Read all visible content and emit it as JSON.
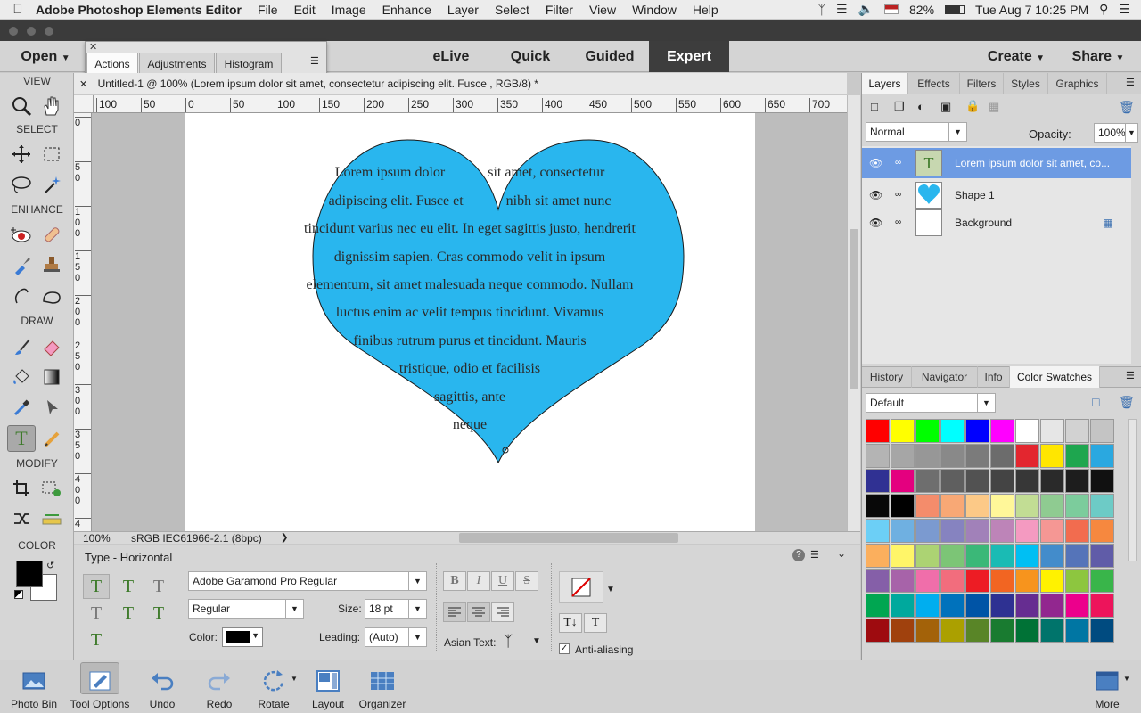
{
  "menubar": {
    "app": "Adobe Photoshop Elements Editor",
    "items": [
      "File",
      "Edit",
      "Image",
      "Enhance",
      "Layer",
      "Select",
      "Filter",
      "View",
      "Window",
      "Help"
    ],
    "battery": "82%",
    "datetime": "Tue Aug 7  10:25 PM"
  },
  "modebar": {
    "open": "Open",
    "modes": [
      "eLive",
      "Quick",
      "Guided",
      "Expert"
    ],
    "active": "Expert",
    "create": "Create",
    "share": "Share"
  },
  "floatpanel": {
    "tabs": [
      "Actions",
      "Adjustments",
      "Histogram"
    ],
    "active": "Actions"
  },
  "tools": {
    "sections": [
      "VIEW",
      "SELECT",
      "ENHANCE",
      "DRAW",
      "MODIFY",
      "COLOR"
    ]
  },
  "document": {
    "tab_title": "Untitled-1 @ 100% (Lorem ipsum dolor sit amet, consectetur adipiscing elit. Fusce , RGB/8) *",
    "zoom": "100%",
    "profile": "sRGB IEC61966-2.1 (8bpc)"
  },
  "rulers": {
    "h": [
      "100",
      "50",
      "0",
      "50",
      "100",
      "150",
      "200",
      "250",
      "300",
      "350",
      "400",
      "450",
      "500",
      "550",
      "600",
      "650",
      "700"
    ],
    "v": [
      "0",
      "5\n0",
      "1\n0\n0",
      "1\n5\n0",
      "2\n0\n0",
      "2\n5\n0",
      "3\n0\n0",
      "3\n5\n0",
      "4\n0\n0",
      "4"
    ]
  },
  "heart": {
    "fill": "#29b6ee",
    "lines": [
      "Lorem ipsum dolor            sit amet, consectetur",
      "adipiscing elit. Fusce et            nibh sit amet nunc",
      "tincidunt varius nec eu elit. In eget sagittis justo, hendrerit",
      "dignissim sapien. Cras commodo velit in ipsum",
      "elementum, sit amet malesuada neque commodo. Nullam",
      "luctus enim ac velit tempus tincidunt. Vivamus",
      "finibus rutrum purus et tincidunt. Mauris",
      "tristique, odio et facilisis",
      "sagittis, ante",
      "neque"
    ]
  },
  "tooloptions": {
    "title": "Type - Horizontal",
    "font": "Adobe Garamond Pro Regular",
    "style": "Regular",
    "size_label": "Size:",
    "size": "18 pt",
    "color_label": "Color:",
    "leading_label": "Leading:",
    "leading": "(Auto)",
    "asian_label": "Asian Text:",
    "antialias": "Anti-aliasing"
  },
  "layers_panel": {
    "tabs": [
      "Layers",
      "Effects",
      "Filters",
      "Styles",
      "Graphics"
    ],
    "active": "Layers",
    "blend": "Normal",
    "opacity_label": "Opacity:",
    "opacity": "100%",
    "layers": [
      "Lorem ipsum dolor sit amet, co...",
      "Shape 1",
      "Background"
    ]
  },
  "swatch_panel": {
    "tabs": [
      "History",
      "Navigator",
      "Info",
      "Color Swatches"
    ],
    "active": "Color Swatches",
    "preset": "Default",
    "colors": [
      "#ff0000",
      "#ffff00",
      "#00ff00",
      "#00ffff",
      "#0000ff",
      "#ff00ff",
      "#ffffff",
      "#e6e6e6",
      "#d2d2d2",
      "#c4c4c4",
      "#b4b4b4",
      "#a6a6a6",
      "#979797",
      "#898989",
      "#7b7b7b",
      "#6c6c6c",
      "#e3262f",
      "#ffe600",
      "#1ea64f",
      "#2aa8e0",
      "#303193",
      "#e4007f",
      "#6e6e6e",
      "#5f5f5f",
      "#525252",
      "#444444",
      "#373737",
      "#2a2a2a",
      "#1d1d1d",
      "#111111",
      "#080808",
      "#000000",
      "#f48c6b",
      "#f8a875",
      "#fcc987",
      "#fff799",
      "#c2dd94",
      "#8fcb91",
      "#7ccc9c",
      "#6dcbc6",
      "#6ccff6",
      "#6fb0e1",
      "#7b9ad0",
      "#8683c0",
      "#a181b9",
      "#bd84b8",
      "#f49ac1",
      "#f59794",
      "#f26c4f",
      "#f6883f",
      "#fbaf5d",
      "#fff568",
      "#acd373",
      "#7cc576",
      "#3bb878",
      "#1abbb4",
      "#00bff3",
      "#438ccb",
      "#5574b9",
      "#605ca8",
      "#855fa8",
      "#a763a9",
      "#f06eaa",
      "#f26d7d",
      "#ed1c24",
      "#f26522",
      "#f7941d",
      "#fff200",
      "#8dc63f",
      "#39b54a",
      "#00a651",
      "#00a99d",
      "#00aeef",
      "#0072bc",
      "#0054a6",
      "#2e3192",
      "#662d91",
      "#92278f",
      "#ec008c",
      "#ed145b",
      "#9e0b0f",
      "#a0410d",
      "#a36209",
      "#aba000",
      "#598527",
      "#197b30",
      "#007236",
      "#00746b",
      "#0076a3",
      "#004b80"
    ]
  },
  "bottombar": {
    "items": [
      "Photo Bin",
      "Tool Options",
      "Undo",
      "Redo",
      "Rotate",
      "Layout",
      "Organizer",
      "More"
    ]
  }
}
